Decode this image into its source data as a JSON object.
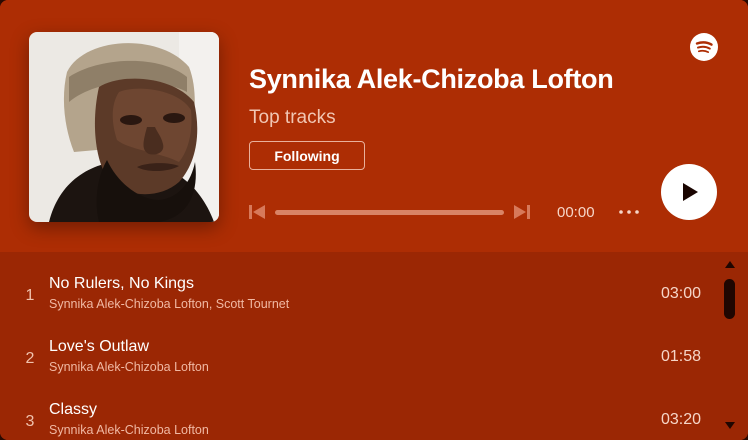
{
  "header": {
    "artist_name": "Synnika Alek-Chizoba Lofton",
    "subtitle": "Top tracks",
    "follow_label": "Following",
    "time": "00:00",
    "progress": 0
  },
  "tracks": [
    {
      "number": "1",
      "title": "No Rulers, No Kings",
      "artists": "Synnika Alek-Chizoba Lofton, Scott Tournet",
      "duration": "03:00"
    },
    {
      "number": "2",
      "title": "Love's Outlaw",
      "artists": "Synnika Alek-Chizoba Lofton",
      "duration": "01:58"
    },
    {
      "number": "3",
      "title": "Classy",
      "artists": "Synnika Alek-Chizoba Lofton",
      "duration": "03:20"
    }
  ],
  "icons": {
    "brand": "spotify-icon",
    "play": "play-icon",
    "previous": "skip-previous-icon",
    "next": "skip-next-icon",
    "more": "more-options-icon"
  },
  "colors": {
    "header_background": "#ad2d04",
    "tracklist_background": "#9b2704",
    "text_primary": "#ffffff"
  }
}
